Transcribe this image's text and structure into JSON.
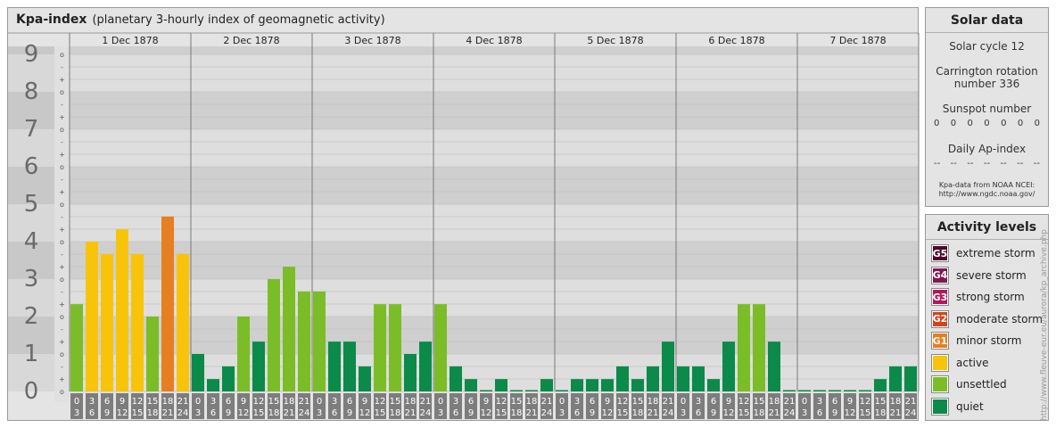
{
  "header": {
    "title": "Kpa-index",
    "subtitle": "(planetary 3-hourly index of geomagnetic activity)"
  },
  "chart_data": {
    "type": "bar",
    "y_levels": [
      "0",
      "1",
      "2",
      "3",
      "4",
      "5",
      "6",
      "7",
      "8",
      "9"
    ],
    "sub_ticks": [
      "o",
      "-",
      "+"
    ],
    "ylim": [
      0,
      9.33
    ],
    "days": [
      "1 Dec 1878",
      "2 Dec 1878",
      "3 Dec 1878",
      "4 Dec 1878",
      "5 Dec 1878",
      "6 Dec 1878",
      "7 Dec 1878"
    ],
    "interval_top": [
      "0",
      "3",
      "6",
      "9",
      "12",
      "15",
      "18",
      "21"
    ],
    "interval_bottom": [
      "3",
      "6",
      "9",
      "12",
      "15",
      "18",
      "21",
      "24"
    ],
    "values": [
      2.33,
      4.0,
      3.67,
      4.33,
      3.67,
      2.0,
      4.67,
      3.67,
      1.0,
      0.33,
      0.67,
      2.0,
      1.33,
      3.0,
      3.33,
      2.67,
      2.67,
      1.33,
      1.33,
      0.67,
      2.33,
      2.33,
      1.0,
      1.33,
      2.33,
      0.67,
      0.33,
      0.0,
      0.33,
      0.0,
      0.0,
      0.33,
      0.0,
      0.33,
      0.33,
      0.33,
      0.67,
      0.33,
      0.67,
      1.33,
      0.67,
      0.67,
      0.33,
      1.33,
      2.33,
      2.33,
      1.33,
      0.0,
      0.0,
      0.0,
      0.0,
      0.0,
      0.0,
      0.33,
      0.67,
      0.67
    ],
    "levels": [
      "unsettled",
      "active",
      "active",
      "active",
      "active",
      "unsettled",
      "minor",
      "active",
      "quiet",
      "quiet",
      "quiet",
      "unsettled",
      "quiet",
      "unsettled",
      "unsettled",
      "unsettled",
      "unsettled",
      "quiet",
      "quiet",
      "quiet",
      "unsettled",
      "unsettled",
      "quiet",
      "quiet",
      "unsettled",
      "quiet",
      "quiet",
      "quiet",
      "quiet",
      "quiet",
      "quiet",
      "quiet",
      "quiet",
      "quiet",
      "quiet",
      "quiet",
      "quiet",
      "quiet",
      "quiet",
      "quiet",
      "quiet",
      "quiet",
      "quiet",
      "quiet",
      "unsettled",
      "unsettled",
      "quiet",
      "quiet",
      "quiet",
      "quiet",
      "quiet",
      "quiet",
      "quiet",
      "quiet",
      "quiet",
      "quiet"
    ]
  },
  "colors": {
    "quiet": "#0b8a4a",
    "unsettled": "#7bbd26",
    "active": "#f8c40a",
    "minor": "#e67e22",
    "moderate": "#d0451b",
    "strong": "#b0195a",
    "severe": "#7c1a52",
    "extreme": "#4a0a2a"
  },
  "solar": {
    "heading": "Solar data",
    "cycle": "Solar cycle 12",
    "rotation_line1": "Carrington rotation",
    "rotation_line2": "number 336",
    "sunspot_label": "Sunspot number",
    "sunspot_values": [
      "0",
      "0",
      "0",
      "0",
      "0",
      "0",
      "0"
    ],
    "ap_label": "Daily Ap-index",
    "ap_values": [
      "--",
      "--",
      "--",
      "--",
      "--",
      "--",
      "--"
    ],
    "credit_line1": "Kpa-data from NOAA NCEI:",
    "credit_line2": "http://www.ngdc.noaa.gov/"
  },
  "activity": {
    "heading": "Activity levels",
    "items": [
      {
        "badge": "G5",
        "label": "extreme storm",
        "color": "#4a0a2a"
      },
      {
        "badge": "G4",
        "label": "severe storm",
        "color": "#7c1a52"
      },
      {
        "badge": "G3",
        "label": "strong storm",
        "color": "#b0195a"
      },
      {
        "badge": "G2",
        "label": "moderate storm",
        "color": "#d0451b"
      },
      {
        "badge": "G1",
        "label": "minor storm",
        "color": "#e67e22"
      },
      {
        "badge": "",
        "label": "active",
        "color": "#f8c40a"
      },
      {
        "badge": "",
        "label": "unsettled",
        "color": "#7bbd26"
      },
      {
        "badge": "",
        "label": "quiet",
        "color": "#0b8a4a"
      }
    ]
  },
  "watermark": "http://www.fleuve-eur.eu/aurora/kp_archive.php"
}
